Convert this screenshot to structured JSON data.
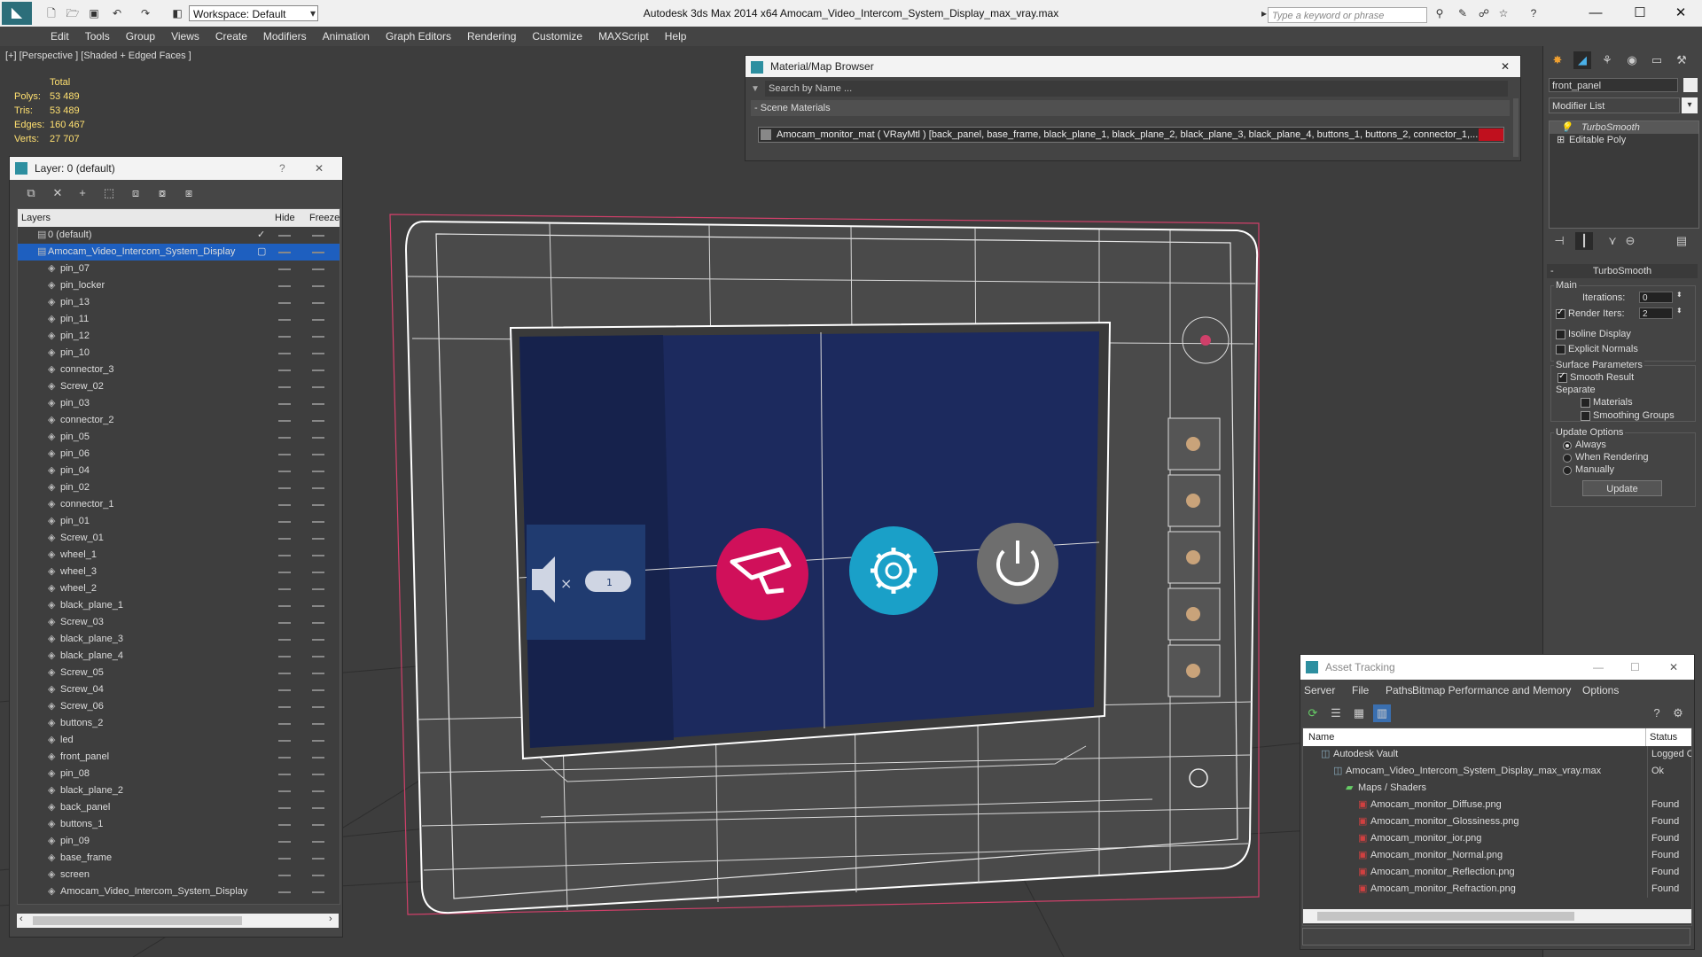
{
  "titlebar": {
    "title": "Autodesk 3ds Max  2014 x64       Amocam_Video_Intercom_System_Display_max_vray.max",
    "workspace": "Workspace: Default",
    "search_placeholder": "Type a keyword or phrase",
    "controls": [
      "—",
      "☐",
      "✕"
    ]
  },
  "menu": [
    "Edit",
    "Tools",
    "Group",
    "Views",
    "Create",
    "Modifiers",
    "Animation",
    "Graph Editors",
    "Rendering",
    "Customize",
    "MAXScript",
    "Help"
  ],
  "viewport": {
    "label": "[+] [Perspective ] [Shaded + Edged Faces ]",
    "stats": {
      "header": "Total",
      "rows": [
        {
          "label": "Polys:",
          "value": "53 489"
        },
        {
          "label": "Tris:",
          "value": "53 489"
        },
        {
          "label": "Edges:",
          "value": "160 467"
        },
        {
          "label": "Verts:",
          "value": "27 707"
        }
      ]
    }
  },
  "layer_panel": {
    "title": "Layer: 0 (default)",
    "help": "?",
    "close": "✕",
    "col_layers": "Layers",
    "col_hide": "Hide",
    "col_freeze": "Freeze",
    "layers": [
      {
        "name": "0 (default)",
        "level": 0
      },
      {
        "name": "Amocam_Video_Intercom_System_Display",
        "level": 0,
        "selected": true
      },
      {
        "name": "pin_07",
        "level": 1
      },
      {
        "name": "pin_locker",
        "level": 1
      },
      {
        "name": "pin_13",
        "level": 1
      },
      {
        "name": "pin_11",
        "level": 1
      },
      {
        "name": "pin_12",
        "level": 1
      },
      {
        "name": "pin_10",
        "level": 1
      },
      {
        "name": "connector_3",
        "level": 1
      },
      {
        "name": "Screw_02",
        "level": 1
      },
      {
        "name": "pin_03",
        "level": 1
      },
      {
        "name": "connector_2",
        "level": 1
      },
      {
        "name": "pin_05",
        "level": 1
      },
      {
        "name": "pin_06",
        "level": 1
      },
      {
        "name": "pin_04",
        "level": 1
      },
      {
        "name": "pin_02",
        "level": 1
      },
      {
        "name": "connector_1",
        "level": 1
      },
      {
        "name": "pin_01",
        "level": 1
      },
      {
        "name": "Screw_01",
        "level": 1
      },
      {
        "name": "wheel_1",
        "level": 1
      },
      {
        "name": "wheel_3",
        "level": 1
      },
      {
        "name": "wheel_2",
        "level": 1
      },
      {
        "name": "black_plane_1",
        "level": 1
      },
      {
        "name": "Screw_03",
        "level": 1
      },
      {
        "name": "black_plane_3",
        "level": 1
      },
      {
        "name": "black_plane_4",
        "level": 1
      },
      {
        "name": "Screw_05",
        "level": 1
      },
      {
        "name": "Screw_04",
        "level": 1
      },
      {
        "name": "Screw_06",
        "level": 1
      },
      {
        "name": "buttons_2",
        "level": 1
      },
      {
        "name": "led",
        "level": 1
      },
      {
        "name": "front_panel",
        "level": 1
      },
      {
        "name": "pin_08",
        "level": 1
      },
      {
        "name": "black_plane_2",
        "level": 1
      },
      {
        "name": "back_panel",
        "level": 1
      },
      {
        "name": "buttons_1",
        "level": 1
      },
      {
        "name": "pin_09",
        "level": 1
      },
      {
        "name": "base_frame",
        "level": 1
      },
      {
        "name": "screen",
        "level": 1
      },
      {
        "name": "Amocam_Video_Intercom_System_Display",
        "level": 1
      }
    ]
  },
  "material_browser": {
    "title": "Material/Map Browser",
    "close": "✕",
    "search_placeholder": "Search by Name ...",
    "section": "- Scene Materials",
    "material": "Amocam_monitor_mat  ( VRayMtl )  [back_panel, base_frame, black_plane_1, black_plane_2, black_plane_3, black_plane_4, buttons_1, buttons_2, connector_1,..."
  },
  "command_panel": {
    "object_name": "front_panel",
    "modifier_list": "Modifier List",
    "stack": [
      "TurboSmooth",
      "Editable Poly"
    ],
    "rollout_title": "TurboSmooth",
    "main_label": "Main",
    "iterations_label": "Iterations:",
    "iterations_value": "0",
    "render_iters_label": "Render Iters:",
    "render_iters_value": "2",
    "isoline": "Isoline Display",
    "explicit_normals": "Explicit Normals",
    "surface_params": "Surface Parameters",
    "smooth_result": "Smooth Result",
    "separate": "Separate",
    "materials": "Materials",
    "smoothing_groups": "Smoothing Groups",
    "update_options": "Update Options",
    "always": "Always",
    "when_rendering": "When Rendering",
    "manually": "Manually",
    "update_button": "Update"
  },
  "asset_tracking": {
    "title": "Asset Tracking",
    "menu": [
      "Server",
      "File",
      "Paths",
      "Bitmap Performance and Memory",
      "Options"
    ],
    "col_name": "Name",
    "col_status": "Status",
    "rows": [
      {
        "name": "Autodesk Vault",
        "status": "Logged Ou",
        "indent": 1
      },
      {
        "name": "Amocam_Video_Intercom_System_Display_max_vray.max",
        "status": "Ok",
        "indent": 2
      },
      {
        "name": "Maps / Shaders",
        "status": "",
        "indent": 3
      },
      {
        "name": "Amocam_monitor_Diffuse.png",
        "status": "Found",
        "indent": 4
      },
      {
        "name": "Amocam_monitor_Glossiness.png",
        "status": "Found",
        "indent": 4
      },
      {
        "name": "Amocam_monitor_ior.png",
        "status": "Found",
        "indent": 4
      },
      {
        "name": "Amocam_monitor_Normal.png",
        "status": "Found",
        "indent": 4
      },
      {
        "name": "Amocam_monitor_Reflection.png",
        "status": "Found",
        "indent": 4
      },
      {
        "name": "Amocam_monitor_Refraction.png",
        "status": "Found",
        "indent": 4
      }
    ]
  },
  "colors": {
    "accent": "#1e5fbf",
    "screen": "#1c2a5e",
    "camera_button": "#d0105a",
    "settings_button": "#1aa0c8",
    "power_button": "#777777",
    "selection_box": "#d0406a"
  }
}
